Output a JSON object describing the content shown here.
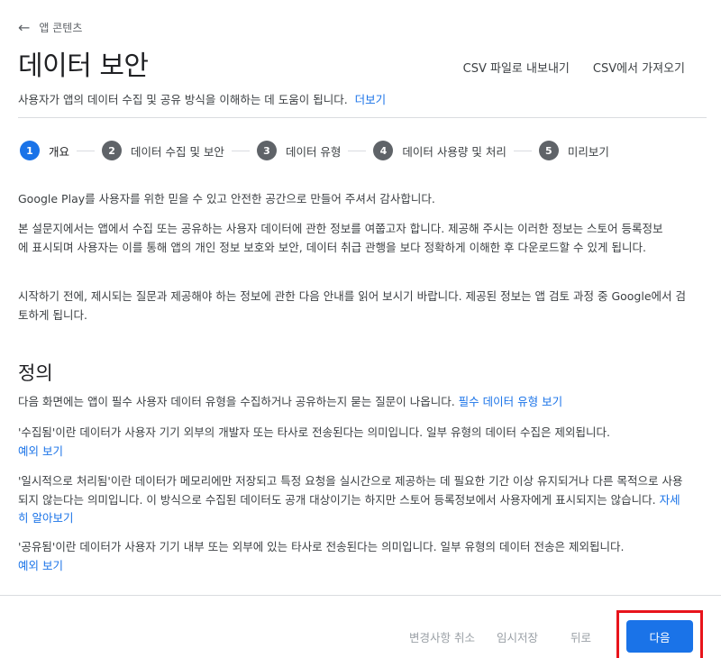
{
  "nav": {
    "back_label": "앱 콘텐츠"
  },
  "page": {
    "title": "데이터 보안"
  },
  "header_actions": {
    "export": "CSV 파일로 내보내기",
    "import": "CSV에서 가져오기"
  },
  "subtitle": {
    "text": "사용자가 앱의 데이터 수집 및 공유 방식을 이해하는 데 도움이 됩니다.",
    "link": "더보기"
  },
  "stepper": {
    "steps": [
      {
        "num": "1",
        "label": "개요",
        "active": true
      },
      {
        "num": "2",
        "label": "데이터 수집 및 보안",
        "active": false
      },
      {
        "num": "3",
        "label": "데이터 유형",
        "active": false
      },
      {
        "num": "4",
        "label": "데이터 사용량 및 처리",
        "active": false
      },
      {
        "num": "5",
        "label": "미리보기",
        "active": false
      }
    ]
  },
  "overview": {
    "thanks": "Google Play를 사용자를 위한 믿을 수 있고 안전한 공간으로 만들어 주셔서 감사합니다.",
    "intro": "본 설문지에서는 앱에서 수집 또는 공유하는 사용자 데이터에 관한 정보를 여쭙고자 합니다. 제공해 주시는 이러한 정보는 스토어 등록정보에 표시되며 사용자는 이를 통해 앱의 개인 정보 보호와 보안, 데이터 취급 관행을 보다 정확하게 이해한 후 다운로드할 수 있게 됩니다.",
    "start": "시작하기 전에, 제시되는 질문과 제공해야 하는 정보에 관한 다음 안내를 읽어 보시기 바랍니다. 제공된 정보는 앱 검토 과정 중 Google에서 검토하게 됩니다."
  },
  "definitions": {
    "title": "정의",
    "intro_text": "다음 화면에는 앱이 필수 사용자 데이터 유형을 수집하거나 공유하는지 묻는 질문이 나옵니다.",
    "intro_link": "필수 데이터 유형 보기",
    "collected_text": "'수집됨'이란 데이터가 사용자 기기 외부의 개발자 또는 타사로 전송된다는 의미입니다. 일부 유형의 데이터 수집은 제외됩니다.",
    "collected_link": "예외 보기",
    "ephemeral_text": "'일시적으로 처리됨'이란 데이터가 메모리에만 저장되고 특정 요청을 실시간으로 제공하는 데 필요한 기간 이상 유지되거나 다른 목적으로 사용되지 않는다는 의미입니다. 이 방식으로 수집된 데이터도 공개 대상이기는 하지만 스토어 등록정보에서 사용자에게 표시되지는 않습니다.",
    "ephemeral_link": "자세히 알아보기",
    "shared_text": "'공유됨'이란 데이터가 사용자 기기 내부 또는 외부에 있는 타사로 전송된다는 의미입니다. 일부 유형의 데이터 전송은 제외됩니다.",
    "shared_link": "예외 보기"
  },
  "footer": {
    "discard": "변경사항 취소",
    "save_draft": "임시저장",
    "back": "뒤로",
    "next": "다음"
  },
  "colors": {
    "accent": "#1a73e8",
    "highlight_box": "#e8141c",
    "disabled_text": "#9aa0a6"
  }
}
